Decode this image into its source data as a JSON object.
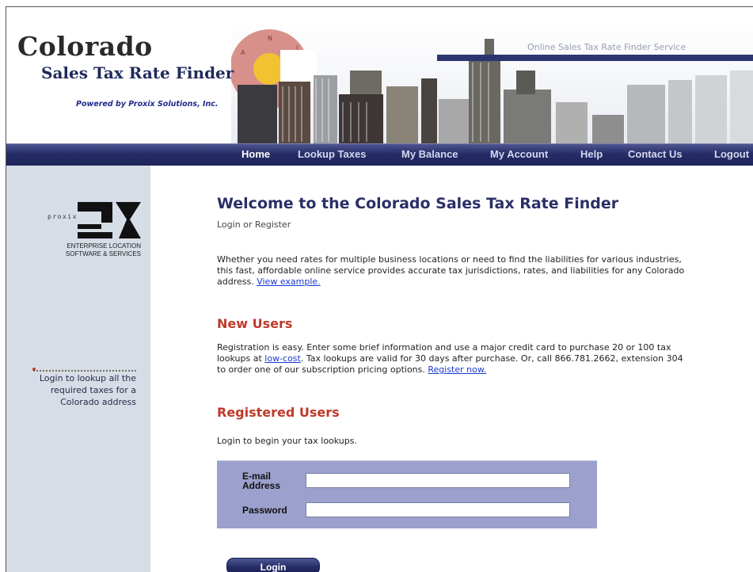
{
  "header": {
    "logo_title": "Colorado",
    "logo_subtitle": "Sales Tax Rate Finder",
    "powered_by": "Powered by Proxix Solutions, Inc.",
    "service_label": "Online Sales Tax Rate Finder Service"
  },
  "nav": {
    "items": [
      {
        "label": "Home",
        "active": true
      },
      {
        "label": "Lookup Taxes"
      },
      {
        "label": "My Balance"
      },
      {
        "label": "My Account"
      },
      {
        "label": "Help"
      },
      {
        "label": "Contact Us"
      },
      {
        "label": "Logout"
      }
    ]
  },
  "sidebar": {
    "logo_word": "proxix",
    "tagline_1": "ENTERPRISE LOCATION",
    "tagline_2": "SOFTWARE & SERVICES",
    "callout_1": "Login to lookup all the",
    "callout_2": "required taxes for a",
    "callout_3": "Colorado address"
  },
  "main": {
    "title": "Welcome to the Colorado Sales Tax Rate Finder",
    "subtitle": "Login or Register",
    "intro_line_1": "Whether you need rates for multiple business locations or need to find the liabilities for various industries,",
    "intro_line_2": "this fast, affordable online service provides accurate tax jurisdictions, rates, and liabilities for any Colorado",
    "intro_line_3": "address. ",
    "intro_link": "View example.",
    "new_users_heading": "New Users",
    "new_users_line_1": "Registration is easy. Enter some brief information and use a major credit card to purchase 20 or 100 tax",
    "new_users_line_2a": "lookups at ",
    "new_users_low_cost": "low-cost",
    "new_users_line_2b": ". Tax lookups are valid for 30 days after purchase. Or, call 866.781.2662, extension 304",
    "new_users_line_3": "to order one of our subscription pricing options. ",
    "register_link": "Register now.",
    "registered_heading": "Registered Users",
    "registered_text": "Login to begin your tax lookups."
  },
  "form": {
    "email_label_1": "E-mail",
    "email_label_2": "Address",
    "email_value": "",
    "password_label": "Password",
    "password_value": "",
    "login_button": "Login"
  },
  "colors": {
    "nav_bg": "#262d68",
    "sidebar_bg": "#d6dde6",
    "heading_blue": "#2a2f66",
    "heading_red": "#c0392b",
    "form_bg": "#9ba0cc",
    "link": "#1a3ad0"
  }
}
